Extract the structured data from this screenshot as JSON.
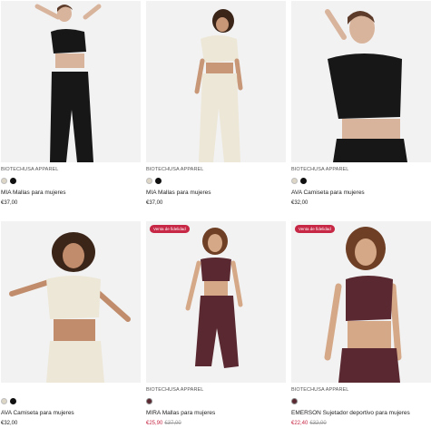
{
  "colors": {
    "sale_badge": "#c72845",
    "sale_price": "#c72845",
    "black": "#111111",
    "cream": "#ddd6c6",
    "burgundy": "#5a2830"
  },
  "products": [
    {
      "brand": "BIOTECHUSA APPAREL",
      "title": "MIA Mallas para mujeres",
      "price": "€37,00",
      "swatches": [
        "cream",
        "black"
      ]
    },
    {
      "brand": "BIOTECHUSA APPAREL",
      "title": "MIA Mallas para mujeres",
      "price": "€37,00",
      "swatches": [
        "cream",
        "black"
      ]
    },
    {
      "brand": "BIOTECHUSA APPAREL",
      "title": "AVA Camiseta para mujeres",
      "price": "€32,00",
      "swatches": [
        "cream",
        "black"
      ]
    },
    {
      "brand": "",
      "title": "AVA Camiseta para mujeres",
      "price": "€32,00",
      "swatches": [
        "cream",
        "black"
      ]
    },
    {
      "badge": "Venta de fidelidad",
      "brand": "BIOTECHUSA APPAREL",
      "title": "MIRA Mallas para mujeres",
      "sale_price": "€25,90",
      "original_price": "€37,00",
      "swatches": [
        "burgundy"
      ]
    },
    {
      "badge": "Venta de fidelidad",
      "brand": "BIOTECHUSA APPAREL",
      "title": "EMERSON Sujetador deportivo para mujeres",
      "sale_price": "€22,40",
      "original_price": "€32,00",
      "swatches": [
        "burgundy"
      ]
    }
  ]
}
